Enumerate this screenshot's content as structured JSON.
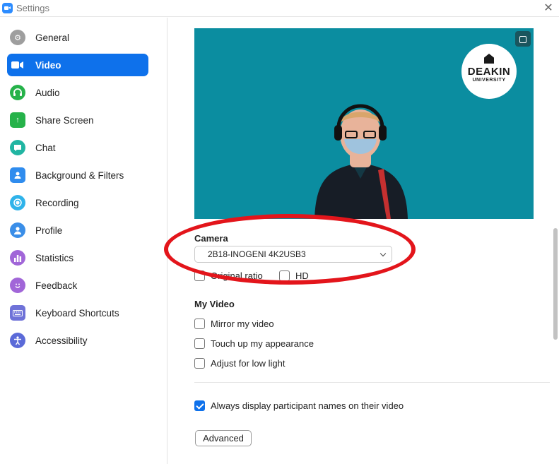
{
  "window": {
    "title": "Settings"
  },
  "sidebar": {
    "items": [
      {
        "label": "General",
        "icon": "gear-icon",
        "color": "#9e9e9e",
        "active": false
      },
      {
        "label": "Video",
        "icon": "video-camera-icon",
        "color": "#ffffff",
        "active": true
      },
      {
        "label": "Audio",
        "icon": "headphones-icon",
        "color": "#26b24a",
        "active": false
      },
      {
        "label": "Share Screen",
        "icon": "share-screen-icon",
        "color": "#26b24a",
        "active": false
      },
      {
        "label": "Chat",
        "icon": "chat-bubble-icon",
        "color": "#21b5a2",
        "active": false
      },
      {
        "label": "Background & Filters",
        "icon": "person-background-icon",
        "color": "#2f8cee",
        "active": false
      },
      {
        "label": "Recording",
        "icon": "record-icon",
        "color": "#2fb3ea",
        "active": false
      },
      {
        "label": "Profile",
        "icon": "person-icon",
        "color": "#3a8ee8",
        "active": false
      },
      {
        "label": "Statistics",
        "icon": "bar-chart-icon",
        "color": "#a166d8",
        "active": false
      },
      {
        "label": "Feedback",
        "icon": "smiley-icon",
        "color": "#a166d8",
        "active": false
      },
      {
        "label": "Keyboard Shortcuts",
        "icon": "keyboard-icon",
        "color": "#6f72d8",
        "active": false
      },
      {
        "label": "Accessibility",
        "icon": "accessibility-icon",
        "color": "#5b6ad8",
        "active": false
      }
    ]
  },
  "preview": {
    "logo_name": "DEAKIN",
    "logo_sub": "UNIVERSITY",
    "background_color": "#0b8da0"
  },
  "camera": {
    "label": "Camera",
    "selected": "2B18-INOGENI 4K2USB3"
  },
  "options": {
    "original_ratio": {
      "label": "Original ratio",
      "checked": false
    },
    "hd": {
      "label": "HD",
      "checked": false
    }
  },
  "my_video": {
    "label": "My Video",
    "mirror": {
      "label": "Mirror my video",
      "checked": false
    },
    "touch_up": {
      "label": "Touch up my appearance",
      "checked": false
    },
    "low_light": {
      "label": "Adjust for low light",
      "checked": false
    }
  },
  "participants": {
    "always_names": {
      "label": "Always display participant names on their video",
      "checked": true
    }
  },
  "advanced_label": "Advanced",
  "colors": {
    "accent": "#0e71eb",
    "annotation": "#e3151b"
  }
}
